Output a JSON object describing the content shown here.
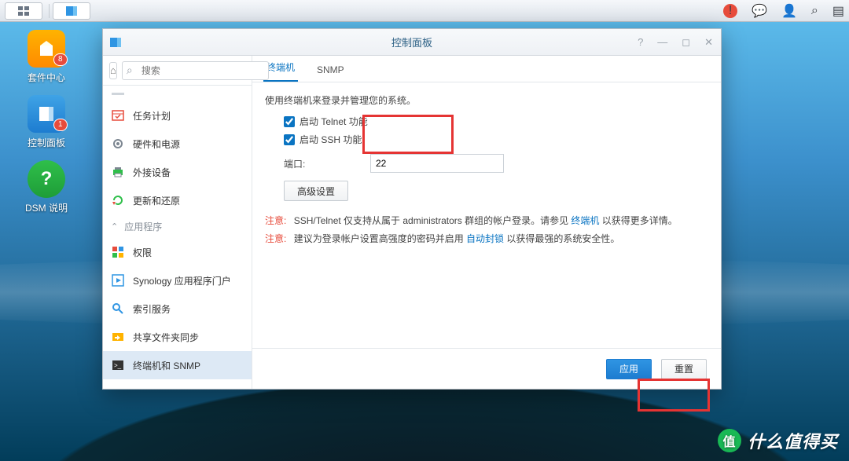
{
  "taskbar": {
    "alert_badge": "!"
  },
  "desktop": {
    "icons": [
      {
        "label": "套件中心",
        "badge": "8"
      },
      {
        "label": "控制面板",
        "badge": "1"
      },
      {
        "label": "DSM 说明",
        "badge": ""
      }
    ]
  },
  "window": {
    "title": "控制面板",
    "search_placeholder": "搜索",
    "sidebar": {
      "items_top": [
        {
          "label": "任务计划"
        },
        {
          "label": "硬件和电源"
        },
        {
          "label": "外接设备"
        },
        {
          "label": "更新和还原"
        }
      ],
      "category": "应用程序",
      "items_bottom": [
        {
          "label": "权限"
        },
        {
          "label": "Synology 应用程序门户"
        },
        {
          "label": "索引服务"
        },
        {
          "label": "共享文件夹同步"
        },
        {
          "label": "终端机和 SNMP"
        }
      ]
    },
    "tabs": [
      {
        "label": "终端机",
        "active": true
      },
      {
        "label": "SNMP",
        "active": false
      }
    ],
    "content": {
      "desc": "使用终端机来登录并管理您的系统。",
      "telnet_label": "启动 Telnet 功能",
      "ssh_label": "启动 SSH 功能",
      "port_label": "端口:",
      "port_value": "22",
      "advanced_button": "高级设置",
      "note_label": "注意:",
      "note1_prefix": "SSH/Telnet 仅支持从属于 administrators 群组的帐户登录。请参见 ",
      "note1_link": "终端机",
      "note1_suffix": " 以获得更多详情。",
      "note2_prefix": "建议为登录帐户设置高强度的密码并启用 ",
      "note2_link": "自动封锁",
      "note2_suffix": " 以获得最强的系统安全性。"
    },
    "footer": {
      "apply": "应用",
      "reset": "重置"
    }
  },
  "watermark": "什么值得买"
}
